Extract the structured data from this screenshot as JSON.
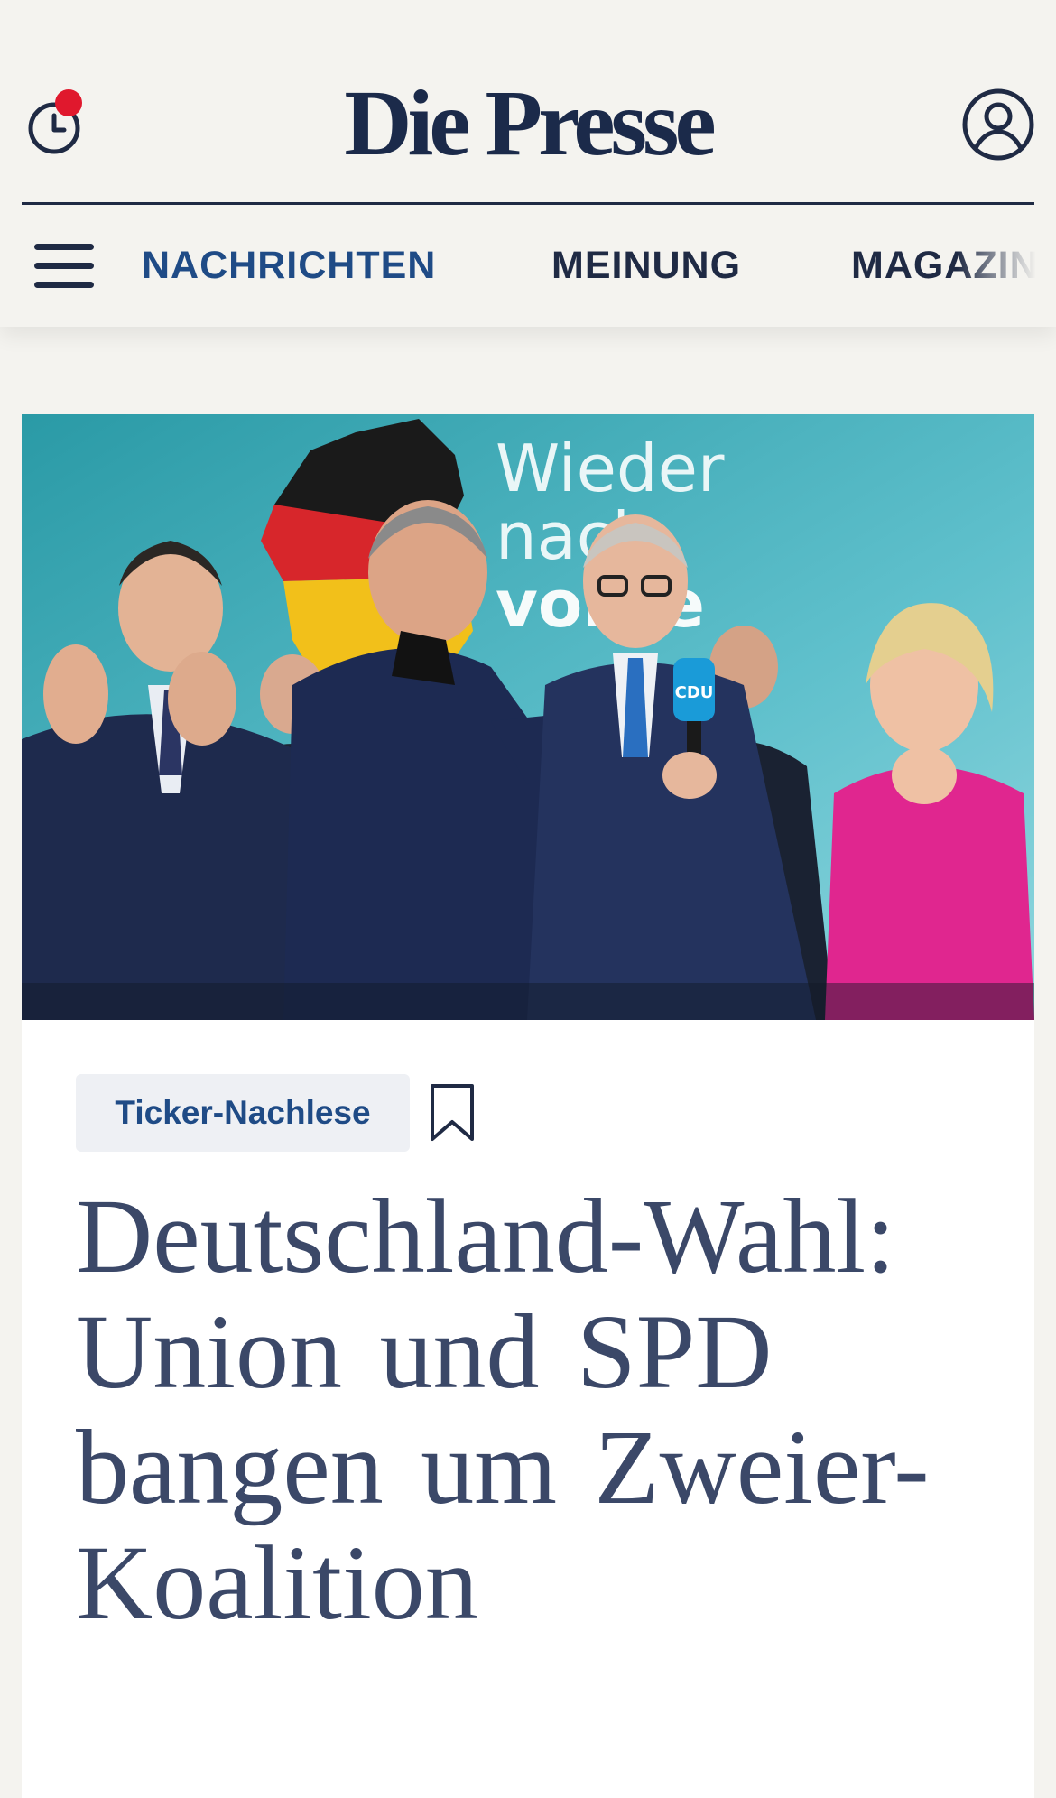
{
  "header": {
    "logo_text": "Die Presse",
    "history_icon": "clock-icon",
    "notification_color": "#e0182d",
    "account_icon": "user-icon"
  },
  "nav": {
    "menu_icon": "hamburger-icon",
    "items": [
      {
        "label": "NACHRICHTEN",
        "active": true
      },
      {
        "label": "MEINUNG",
        "active": false
      },
      {
        "label": "MAGAZIN",
        "active": false
      }
    ]
  },
  "article": {
    "image_alt": "Politiker feiern auf der Wahlparty vor einer Wand mit der Aufschrift 'Wieder nach vorne'",
    "image_wall_text": [
      "Wieder",
      "nach",
      "vorne"
    ],
    "microphone_label": "CDU",
    "badge": "Ticker-Nachlese",
    "bookmark_icon": "bookmark-icon",
    "headline": "Deutschland-Wahl: Union und SPD bangen um Zweier-Koalition"
  },
  "colors": {
    "brand_navy": "#1b2a4a",
    "accent_blue": "#1f4b86",
    "page_background": "#f4f3ef",
    "headline_color": "#3b4868"
  }
}
